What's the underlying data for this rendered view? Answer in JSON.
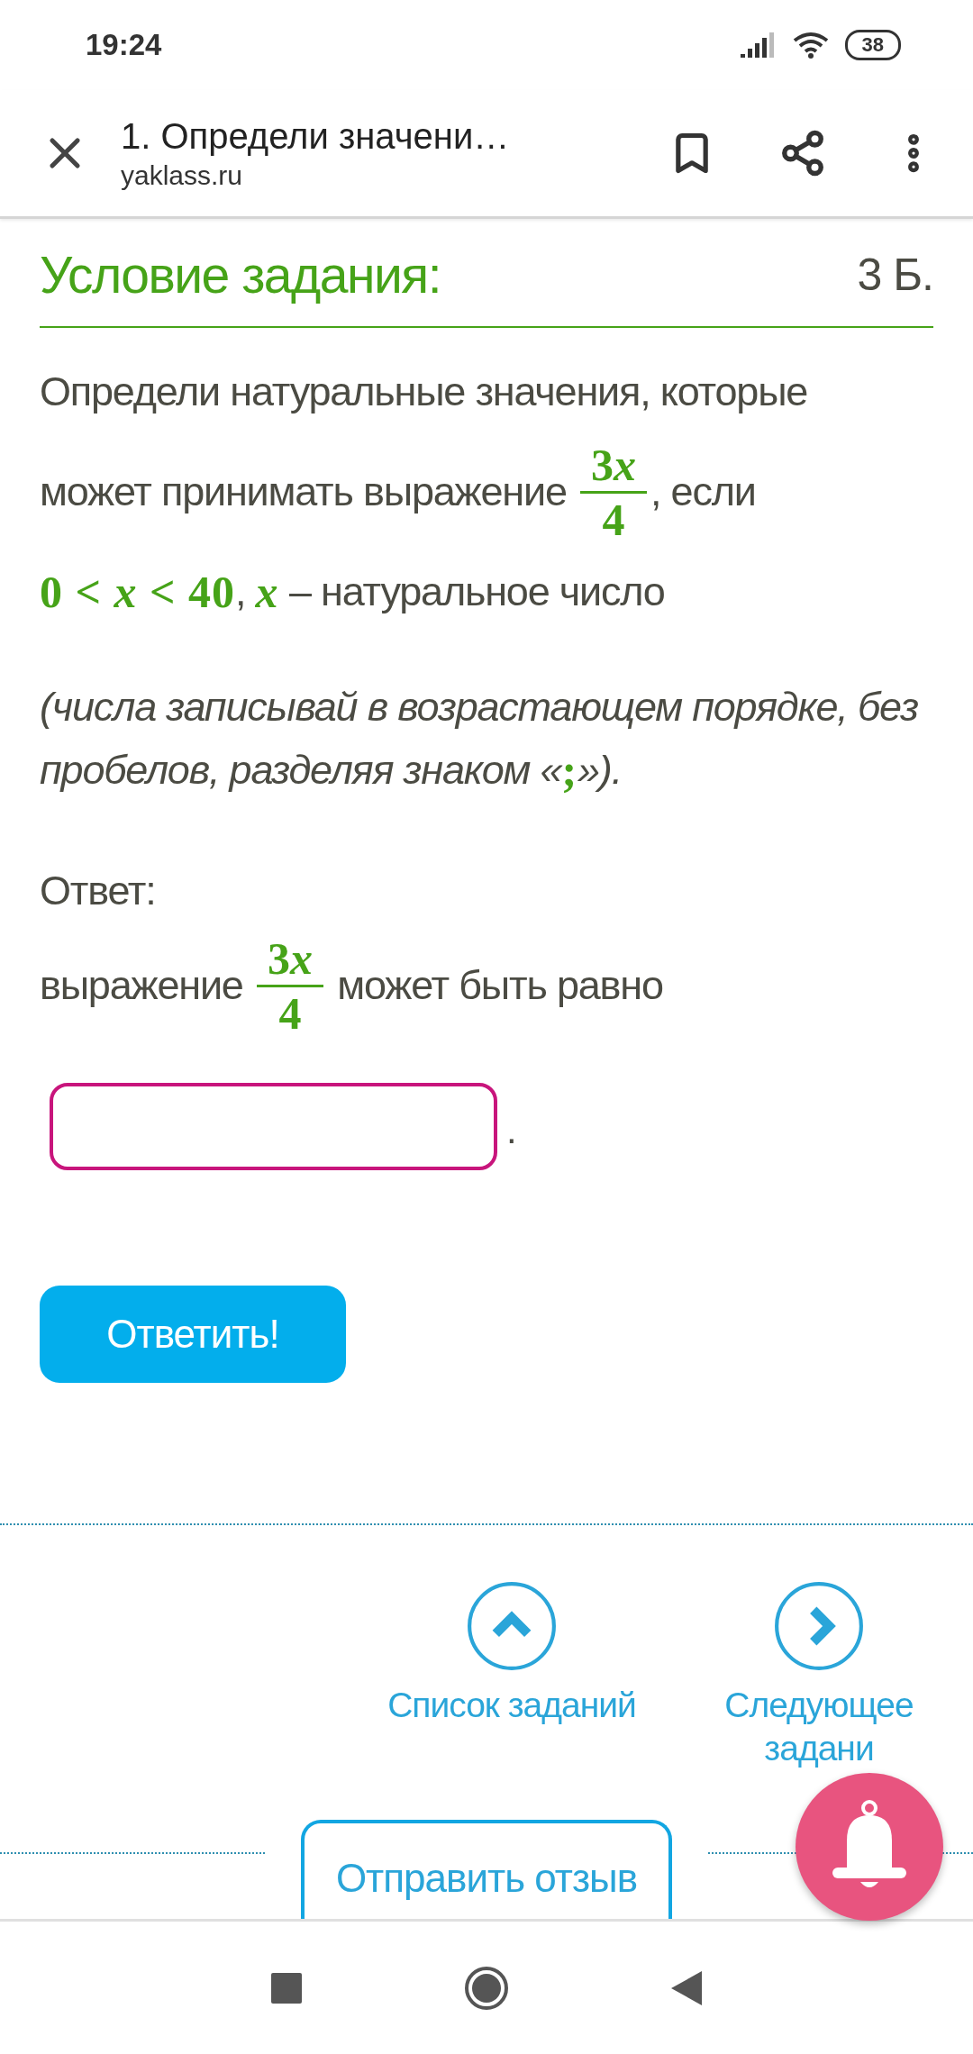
{
  "status_bar": {
    "time": "19:24",
    "battery": "38"
  },
  "browser_bar": {
    "title": "1. Определи значени…",
    "url": "yaklass.ru"
  },
  "task": {
    "heading": "Условие задания:",
    "points": "3 Б.",
    "question_lines": [
      [
        {
          "kind": "text",
          "text": "Определи натуральные значения, которые"
        }
      ],
      [
        {
          "kind": "text",
          "text": "может принимать выражение "
        },
        {
          "kind": "fraction",
          "coefficient": "3",
          "variable": "x",
          "denominator": "4"
        },
        {
          "kind": "text",
          "text": ", если"
        }
      ],
      [
        {
          "kind": "math",
          "text": "0 < *x* < 40"
        },
        {
          "kind": "text",
          "text": ", "
        },
        {
          "kind": "math",
          "text": "*x*"
        },
        {
          "kind": "text",
          "text": " – натуральное число"
        }
      ]
    ],
    "note_lines": [
      [
        {
          "kind": "text",
          "text": "(числа записывай в возрастающем порядке, без"
        }
      ],
      [
        {
          "kind": "text",
          "text": "пробелов, разделяя знаком «"
        },
        {
          "kind": "math",
          "text": ";"
        },
        {
          "kind": "text",
          "text": "»)."
        }
      ]
    ]
  },
  "answer": {
    "label": "Ответ:",
    "line": [
      {
        "kind": "text",
        "text": "выражение "
      },
      {
        "kind": "fraction",
        "coefficient": "3",
        "variable": "x",
        "denominator": "4"
      },
      {
        "kind": "text",
        "text": " может быть равно"
      }
    ],
    "field_suffix": ".",
    "submit": "Ответить!"
  },
  "navigation": [
    {
      "kind": "up",
      "label": "Список заданий"
    },
    {
      "kind": "next",
      "label": "Следующее задани"
    }
  ],
  "feedback_button": "Отправить отзыв"
}
